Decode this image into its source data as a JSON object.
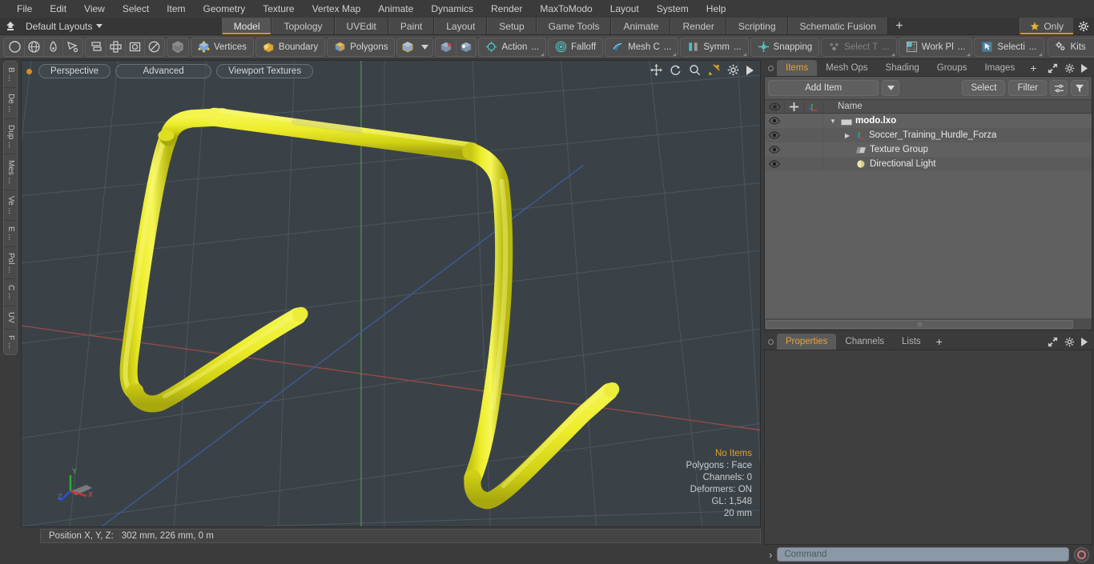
{
  "app": {
    "title": "modo",
    "accent": "#e0921f",
    "viewport_bg": "#3a4248",
    "model_color": "#e8e82a"
  },
  "menubar": {
    "items": [
      {
        "label": "File"
      },
      {
        "label": "Edit"
      },
      {
        "label": "View"
      },
      {
        "label": "Select"
      },
      {
        "label": "Item"
      },
      {
        "label": "Geometry"
      },
      {
        "label": "Texture"
      },
      {
        "label": "Vertex Map"
      },
      {
        "label": "Animate"
      },
      {
        "label": "Dynamics"
      },
      {
        "label": "Render"
      },
      {
        "label": "MaxToModo"
      },
      {
        "label": "Layout"
      },
      {
        "label": "System"
      },
      {
        "label": "Help"
      }
    ]
  },
  "layoutbar": {
    "home_icon": "home-up-icon",
    "layouts_label": "Default Layouts",
    "layouts_caret": "chevron-down-icon",
    "tabs": [
      {
        "label": "Model",
        "active": true
      },
      {
        "label": "Topology",
        "active": false
      },
      {
        "label": "UVEdit",
        "active": false
      },
      {
        "label": "Paint",
        "active": false
      },
      {
        "label": "Layout",
        "active": false
      },
      {
        "label": "Setup",
        "active": false
      },
      {
        "label": "Game Tools",
        "active": false
      },
      {
        "label": "Animate",
        "active": false
      },
      {
        "label": "Render",
        "active": false
      },
      {
        "label": "Scripting",
        "active": false
      },
      {
        "label": "Schematic Fusion",
        "active": false
      }
    ],
    "add_tab_label": "+",
    "only_label": "Only",
    "only_icon": "star-icon",
    "gear_icon": "gear-icon"
  },
  "toolbar": {
    "group1": [
      {
        "icon": "circle-icon",
        "name": "falloff-none-icon"
      },
      {
        "icon": "globe-icon",
        "name": "globe-icon"
      },
      {
        "icon": "pen-icon",
        "name": "pen-icon"
      },
      {
        "icon": "lasso-icon",
        "name": "lasso-icon"
      }
    ],
    "group2": [
      {
        "icon": "align-icon",
        "name": "align-icon"
      },
      {
        "icon": "center-icon",
        "name": "center-icon"
      },
      {
        "icon": "bbox-icon",
        "name": "bounding-box-icon"
      },
      {
        "icon": "ellipse-icon",
        "name": "ellipse-icon"
      }
    ],
    "group3": [
      {
        "icon": "cube-gray-icon",
        "name": "item-mode-icon"
      }
    ],
    "selection_modes": [
      {
        "label": "Vertices",
        "icon": "vertices-cube-icon"
      },
      {
        "label": "Boundary",
        "icon": "boundary-cube-icon"
      },
      {
        "label": "Polygons",
        "icon": "polygons-cube-icon"
      }
    ],
    "cube_drop": {
      "icon": "cube-yellow-icon",
      "caret": "chevron-down-icon"
    },
    "snap_icons": [
      {
        "name": "workplane-align-icon"
      },
      {
        "name": "workplane-fit-icon"
      }
    ],
    "tools": [
      {
        "label": "Action",
        "suffix": "...",
        "icon": "action-center-icon",
        "dim": false
      },
      {
        "label": "Falloff",
        "suffix": "",
        "icon": "falloff-icon",
        "dim": false
      },
      {
        "label": "Mesh C",
        "suffix": "...",
        "icon": "mesh-constraint-icon",
        "dim": false
      },
      {
        "label": "Symm",
        "suffix": "...",
        "icon": "symmetry-icon",
        "dim": false
      },
      {
        "label": "Snapping",
        "suffix": "",
        "icon": "snapping-icon",
        "dim": false
      },
      {
        "label": "Select T",
        "suffix": "...",
        "icon": "select-through-icon",
        "dim": true
      },
      {
        "label": "Work Pl",
        "suffix": "...",
        "icon": "work-plane-icon",
        "dim": false
      },
      {
        "label": "Selecti",
        "suffix": "...",
        "icon": "selection-set-icon",
        "dim": false
      },
      {
        "label": "Kits",
        "suffix": "",
        "icon": "kits-gears-icon",
        "dim": false
      }
    ],
    "right_icons": [
      {
        "name": "unity-export-icon"
      },
      {
        "name": "unreal-export-icon"
      }
    ]
  },
  "left_strip": {
    "tabs": [
      {
        "label": "B ..."
      },
      {
        "label": "De ..."
      },
      {
        "label": "Dup ..."
      },
      {
        "label": "Mes ..."
      },
      {
        "label": "Ve ..."
      },
      {
        "label": "E ..."
      },
      {
        "label": "Pol ..."
      },
      {
        "label": "C ..."
      },
      {
        "label": "UV"
      },
      {
        "label": "F ..."
      }
    ]
  },
  "viewport": {
    "pills": [
      {
        "label": "Perspective",
        "name": "viewport-view-mode"
      },
      {
        "label": "Advanced",
        "name": "viewport-shading-mode"
      },
      {
        "label": "Viewport Textures",
        "name": "viewport-texture-mode"
      }
    ],
    "nav_icons": [
      {
        "name": "pan-icon"
      },
      {
        "name": "rotate-icon"
      },
      {
        "name": "zoom-icon"
      },
      {
        "name": "fit-icon"
      },
      {
        "name": "gear-icon"
      },
      {
        "name": "play-arrow-icon"
      }
    ],
    "stats": [
      {
        "label": "No Items",
        "highlight": true
      },
      {
        "label": "Polygons : Face",
        "highlight": false
      },
      {
        "label": "Channels: 0",
        "highlight": false
      },
      {
        "label": "Deformers: ON",
        "highlight": false
      },
      {
        "label": "GL: 1,548",
        "highlight": false
      },
      {
        "label": "20 mm",
        "highlight": false
      }
    ],
    "axis_labels": {
      "x": "X",
      "y": "Y",
      "z": "Z"
    },
    "status": {
      "label": "Position X, Y, Z:",
      "value": "302 mm, 226 mm, 0 m"
    }
  },
  "right_panel": {
    "top_tabs": [
      {
        "label": "Items",
        "active": true
      },
      {
        "label": "Mesh Ops",
        "active": false
      },
      {
        "label": "Shading",
        "active": false
      },
      {
        "label": "Groups",
        "active": false
      },
      {
        "label": "Images",
        "active": false
      }
    ],
    "top_tabs_plus": "+",
    "top_tools": [
      {
        "name": "expand-icon"
      },
      {
        "name": "gear-icon"
      },
      {
        "name": "play-arrow-icon"
      }
    ],
    "add_item_label": "Add Item",
    "add_item_caret": "chevron-down-icon",
    "select_label": "Select",
    "filter_label": "Filter",
    "filter_list_icon": "filter-list-icon",
    "filter_funnel_icon": "funnel-icon",
    "tree_columns": [
      {
        "name": "eye-icon"
      },
      {
        "name": "lock-move-icon"
      },
      {
        "name": "axis-icon"
      },
      {
        "label": "Name"
      }
    ],
    "tree_rows": [
      {
        "label": "modo.lxo",
        "icon": "scene-clapper-icon",
        "depth": 0,
        "twisty": "▼",
        "root": true
      },
      {
        "label": "Soccer_Training_Hurdle_Forza",
        "icon": "mesh-axis-icon",
        "depth": 1,
        "twisty": "▶",
        "root": false
      },
      {
        "label": "Texture Group",
        "icon": "texture-group-icon",
        "depth": 1,
        "twisty": "",
        "root": false
      },
      {
        "label": "Directional Light",
        "icon": "directional-light-icon",
        "depth": 1,
        "twisty": "",
        "root": false
      }
    ],
    "bottom_tabs": [
      {
        "label": "Properties",
        "active": true
      },
      {
        "label": "Channels",
        "active": false
      },
      {
        "label": "Lists",
        "active": false
      }
    ],
    "bottom_tabs_plus": "+"
  },
  "command_bar": {
    "prompt": "›",
    "placeholder": "Command",
    "value": "",
    "record_icon": "record-circle-icon"
  }
}
